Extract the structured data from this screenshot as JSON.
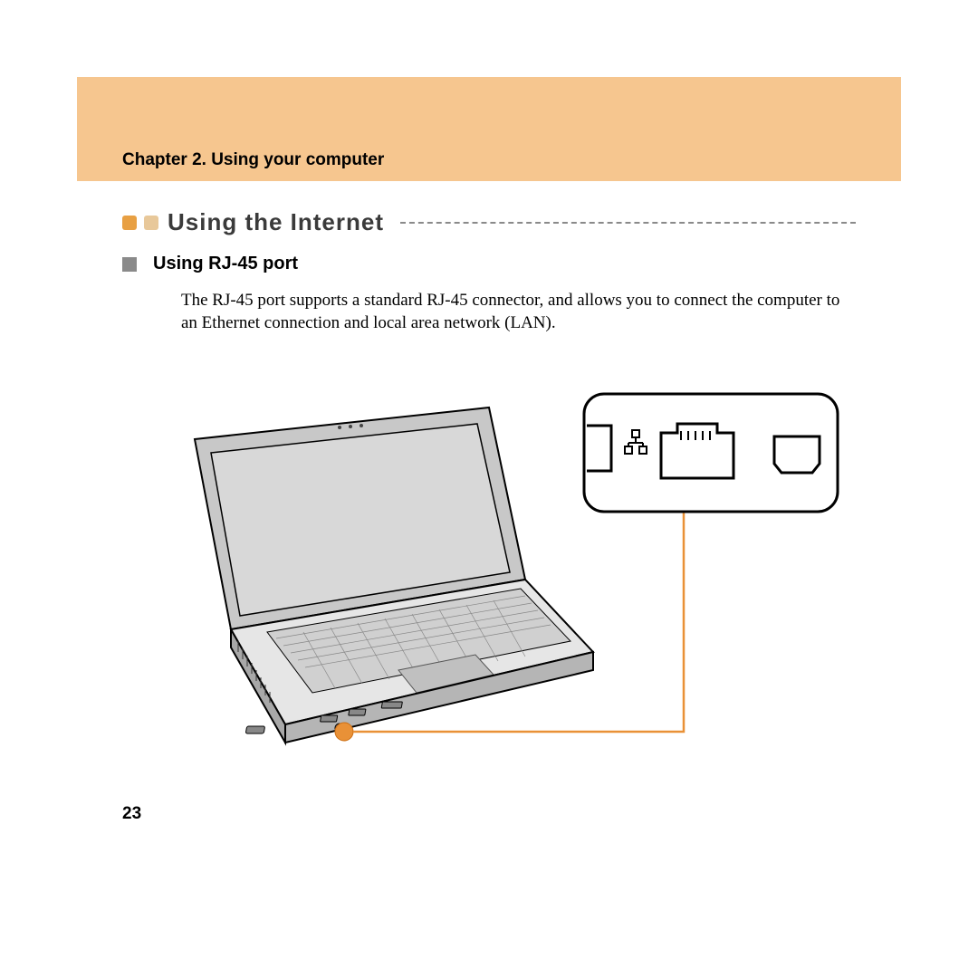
{
  "header": {
    "chapter": "Chapter 2. Using your computer"
  },
  "section": {
    "title": "Using the Internet"
  },
  "subsection": {
    "title": "Using RJ-45 port",
    "body": "The RJ-45 port supports a standard RJ-45 connector, and allows you to connect the computer to an Ethernet connection and local area network (LAN)."
  },
  "page_number": "23",
  "colors": {
    "banner": "#f6c68f",
    "accent_orange": "#e8a043",
    "callout_orange": "#e99137"
  }
}
